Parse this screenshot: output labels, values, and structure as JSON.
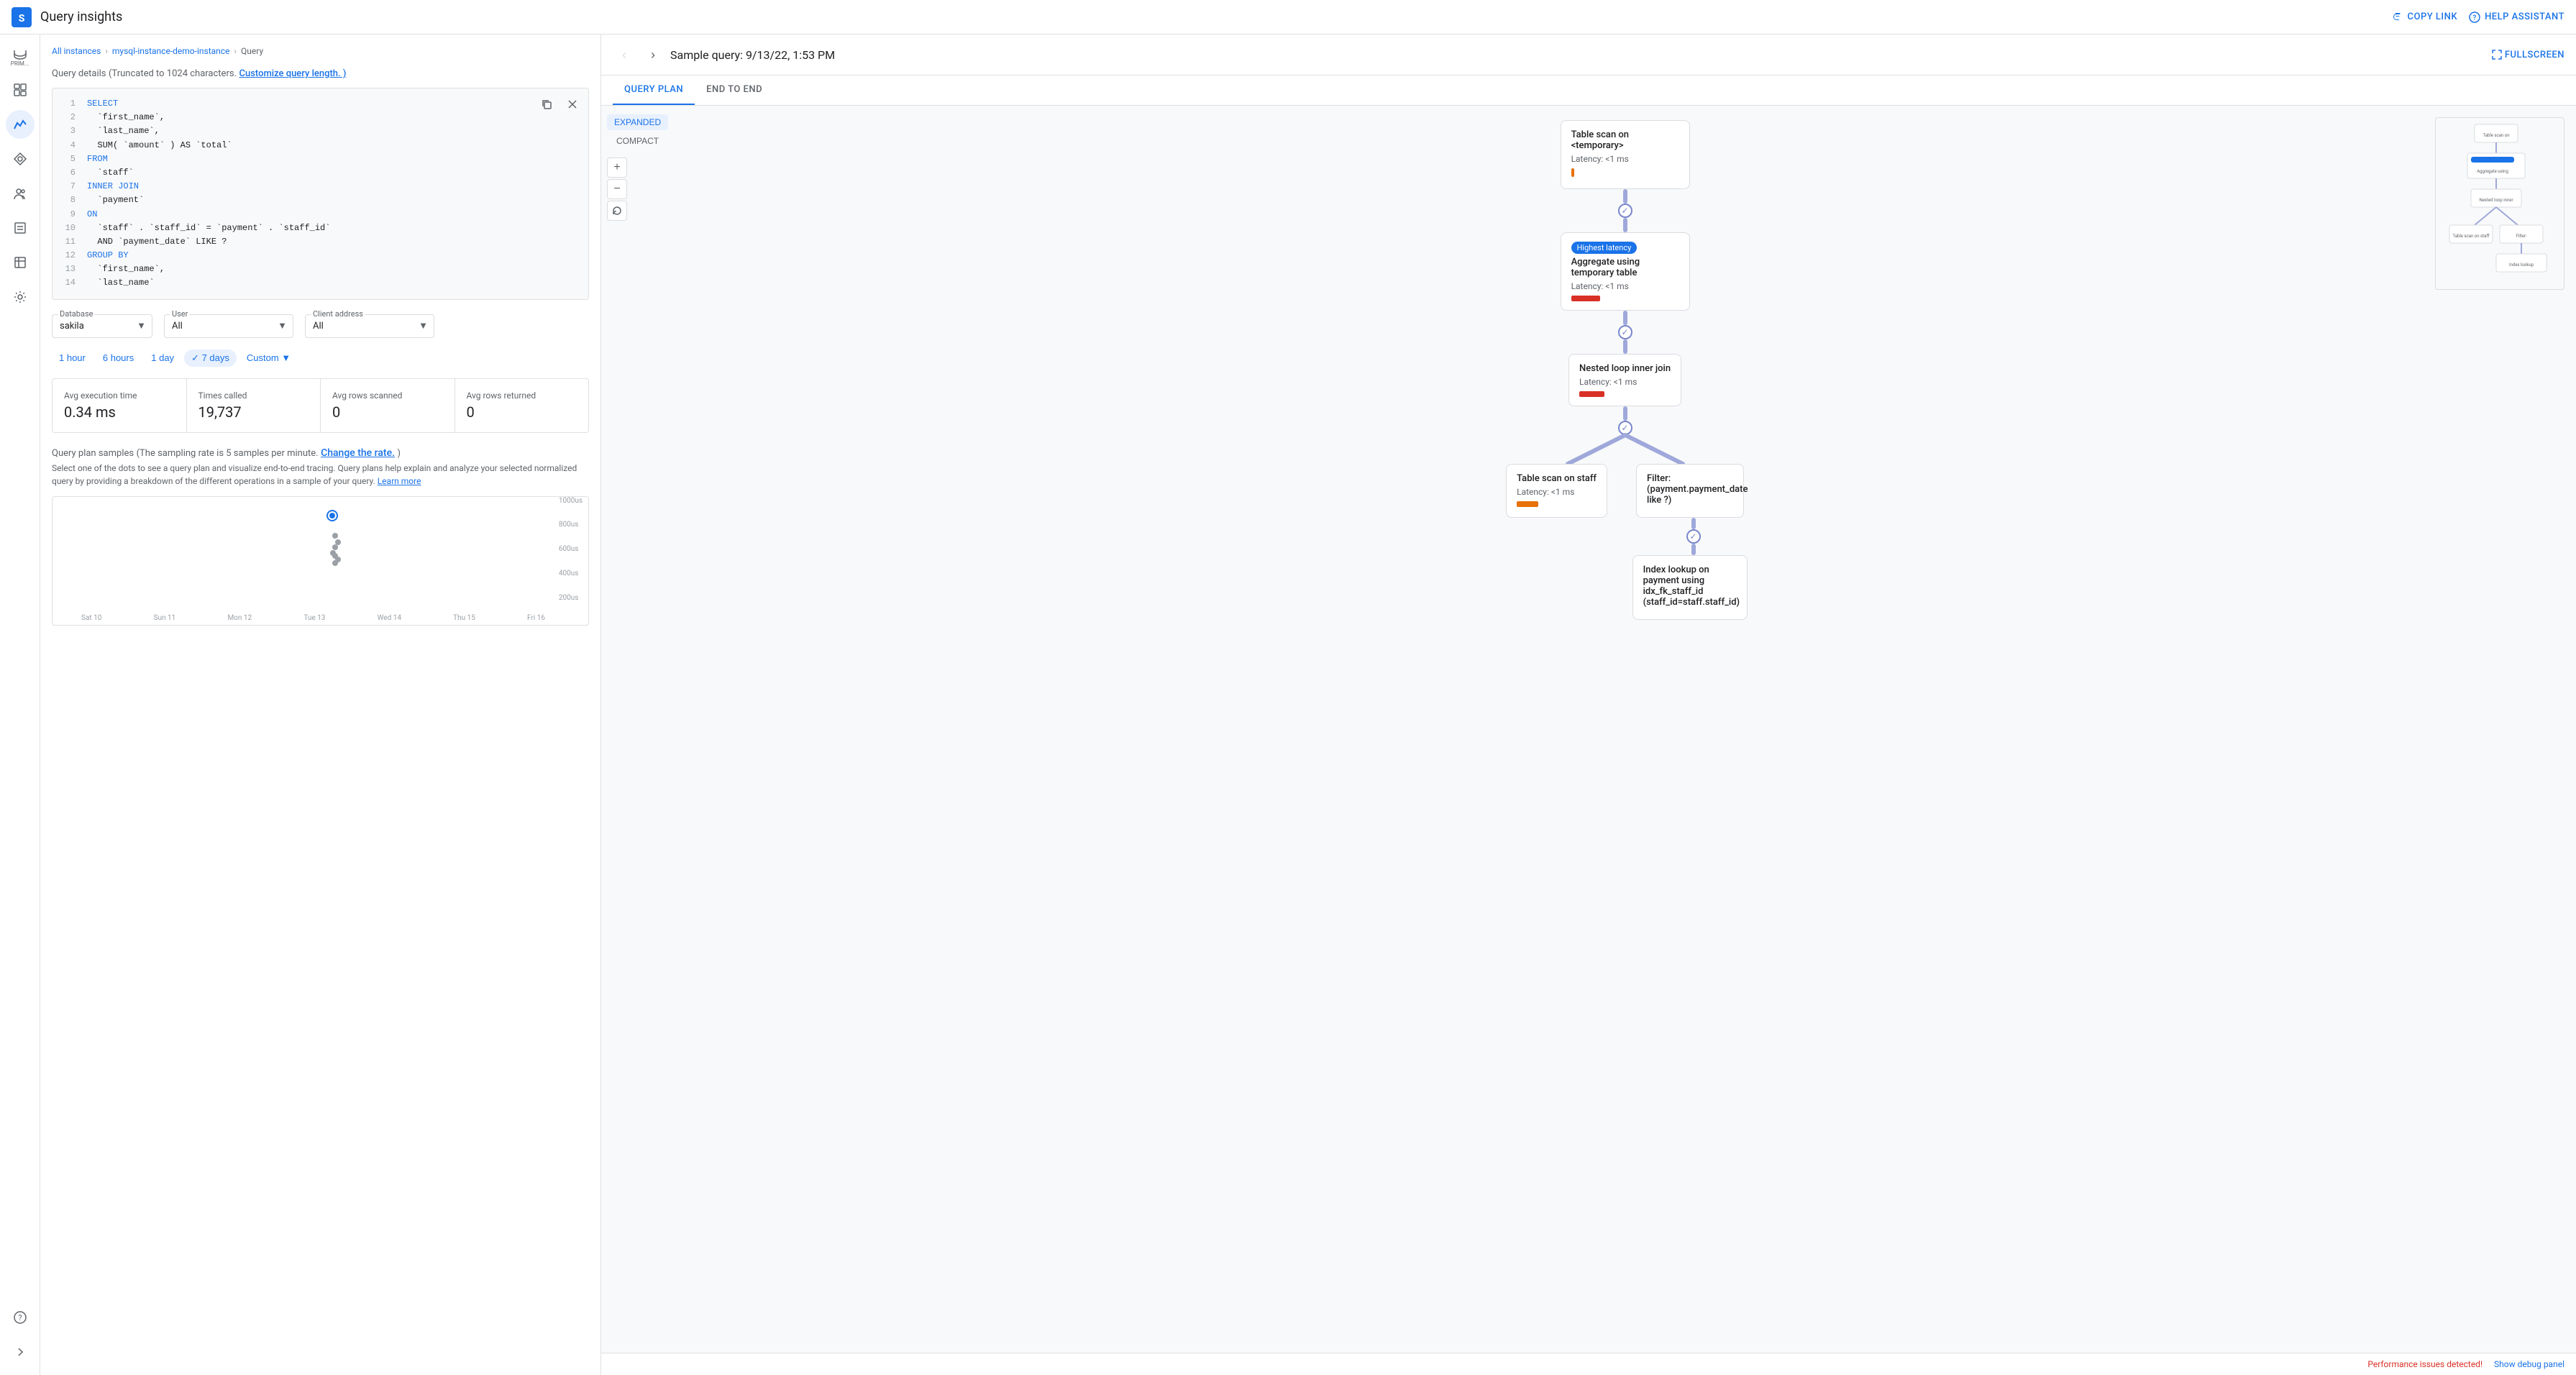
{
  "topbar": {
    "title": "Query insights",
    "copy_link_label": "COPY LINK",
    "help_assistant_label": "HELP ASSISTANT"
  },
  "sidebar": {
    "items": [
      {
        "id": "prim",
        "label": "PRIM...",
        "icon": "database-icon"
      },
      {
        "id": "dashboard",
        "label": "",
        "icon": "dashboard-icon"
      },
      {
        "id": "charts",
        "label": "",
        "icon": "charts-icon",
        "active": true
      },
      {
        "id": "routing",
        "label": "",
        "icon": "routing-icon"
      },
      {
        "id": "users",
        "label": "",
        "icon": "users-icon"
      },
      {
        "id": "logs",
        "label": "",
        "icon": "logs-icon"
      },
      {
        "id": "operations",
        "label": "",
        "icon": "operations-icon"
      },
      {
        "id": "settings",
        "label": "",
        "icon": "settings-icon"
      },
      {
        "id": "support",
        "label": "",
        "icon": "support-icon"
      }
    ]
  },
  "breadcrumb": {
    "items": [
      "All instances",
      "mysql-instance-demo-instance",
      "Query"
    ]
  },
  "query_details": {
    "header": "Query details",
    "subtext": "(Truncated to 1024 characters.",
    "customize_link": "Customize query length. )",
    "lines": [
      {
        "num": 1,
        "code": "SELECT",
        "type": "keyword"
      },
      {
        "num": 2,
        "code": "  `first_name`,"
      },
      {
        "num": 3,
        "code": "  `last_name`,"
      },
      {
        "num": 4,
        "code": "  SUM( `amount` ) AS `total`"
      },
      {
        "num": 5,
        "code": "FROM",
        "type": "keyword"
      },
      {
        "num": 6,
        "code": "  `staff`"
      },
      {
        "num": 7,
        "code": "INNER JOIN",
        "type": "keyword"
      },
      {
        "num": 8,
        "code": "  `payment`"
      },
      {
        "num": 9,
        "code": "ON",
        "type": "keyword"
      },
      {
        "num": 10,
        "code": "  `staff` . `staff_id` = `payment` . `staff_id`"
      },
      {
        "num": 11,
        "code": "  AND `payment_date` LIKE ?"
      },
      {
        "num": 12,
        "code": "GROUP BY",
        "type": "keyword"
      },
      {
        "num": 13,
        "code": "  `first_name`,"
      },
      {
        "num": 14,
        "code": "  `last_name`"
      }
    ]
  },
  "filters": {
    "database_label": "Database",
    "database_value": "sakila",
    "user_label": "User",
    "user_value": "All",
    "client_address_label": "Client address",
    "client_address_value": "All"
  },
  "time_range": {
    "options": [
      "1 hour",
      "6 hours",
      "1 day",
      "7 days",
      "Custom"
    ],
    "active": "7 days"
  },
  "stats": [
    {
      "label": "Avg execution time",
      "value": "0.34 ms"
    },
    {
      "label": "Times called",
      "value": "19,737"
    },
    {
      "label": "Avg rows scanned",
      "value": "0"
    },
    {
      "label": "Avg rows returned",
      "value": "0"
    }
  ],
  "query_plan_samples": {
    "header": "Query plan samples",
    "subtext": "(The sampling rate is 5 samples per minute.",
    "change_rate_link": "Change the rate.",
    "subtext2": ")",
    "description": "Select one of the dots to see a query plan and visualize end-to-end tracing. Query plans help explain and analyze your selected normalized query by providing a breakdown of the different operations in a sample of your query.",
    "learn_more_link": "Learn more",
    "chart": {
      "y_labels": [
        "1000us",
        "800us",
        "600us",
        "400us",
        "200us"
      ],
      "x_labels": [
        "Sat 10",
        "Sun 11",
        "Mon 12",
        "Tue 13",
        "Wed 14",
        "Thu 15",
        "Fri 16"
      ],
      "dots": [
        {
          "x": 58,
          "y": 28,
          "selected": true
        },
        {
          "x": 59,
          "y": 45
        },
        {
          "x": 60,
          "y": 52
        },
        {
          "x": 60,
          "y": 62
        },
        {
          "x": 59,
          "y": 70
        },
        {
          "x": 60,
          "y": 75
        },
        {
          "x": 61,
          "y": 78
        },
        {
          "x": 61,
          "y": 82
        }
      ]
    }
  },
  "right_panel": {
    "sample_title": "Sample query: 9/13/22, 1:53 PM",
    "fullscreen_label": "FULLSCREEN",
    "tabs": [
      "QUERY PLAN",
      "END TO END"
    ],
    "active_tab": "QUERY PLAN",
    "view_modes": [
      "EXPANDED",
      "COMPACT"
    ],
    "active_view": "EXPANDED",
    "plan_nodes": [
      {
        "id": "node1",
        "title": "Table scan on <temporary>",
        "latency": "Latency: <1 ms",
        "bar_color": "orange",
        "level": 0
      },
      {
        "id": "node2",
        "title": "Aggregate using temporary table",
        "latency": "Latency: <1 ms",
        "bar_color": "red",
        "badge": "Highest latency",
        "level": 1
      },
      {
        "id": "node3",
        "title": "Nested loop inner join",
        "latency": "Latency: <1 ms",
        "bar_color": "red",
        "level": 2
      },
      {
        "id": "node4",
        "title": "Table scan on staff",
        "latency": "Latency: <1 ms",
        "bar_color": "orange",
        "level": 3,
        "branch": "left"
      },
      {
        "id": "node5",
        "title": "Filter: (payment.payment_date like ?)",
        "latency": "",
        "bar_color": "none",
        "level": 3,
        "branch": "right"
      },
      {
        "id": "node6",
        "title": "Index lookup on payment using idx_fk_staff_id (staff_id=staff.staff_id)",
        "latency": "",
        "bar_color": "none",
        "level": 4,
        "branch": "right"
      }
    ]
  },
  "bottom_bar": {
    "perf_issue": "Performance issues detected!",
    "debug_label": "Show debug panel"
  }
}
